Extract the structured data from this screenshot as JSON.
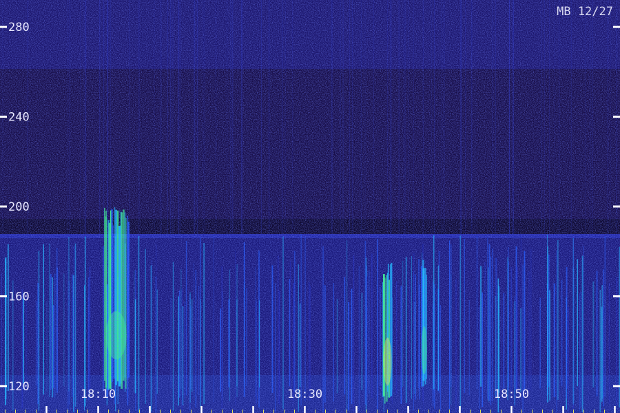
{
  "chart_data": {
    "type": "heatmap",
    "title": "",
    "stamp": "MB 12/27",
    "xlabel": "",
    "ylabel": "",
    "y_ticks": [
      280,
      240,
      200,
      160,
      120
    ],
    "ylim": [
      108,
      292
    ],
    "x_tick_labels": [
      {
        "time": "18:10",
        "minute": 10
      },
      {
        "time": "18:30",
        "minute": 30
      },
      {
        "time": "18:50",
        "minute": 50
      }
    ],
    "xlim_minutes": [
      0.5,
      60.5
    ],
    "minor_tick_every_minutes": 5,
    "colormap": [
      "#1a1050",
      "#1e2ab8",
      "#1f5cff",
      "#19c0ff",
      "#3cff8a",
      "#f0ff40"
    ],
    "intensity_events": [
      {
        "label": "broadband burst",
        "minute_start": 10.5,
        "minute_end": 13,
        "freq_low": 118,
        "freq_high": 200,
        "level": 0.85
      },
      {
        "label": "burst",
        "minute_start": 37.5,
        "minute_end": 38.5,
        "freq_low": 112,
        "freq_high": 175,
        "level": 0.9
      },
      {
        "label": "burst",
        "minute_start": 41.3,
        "minute_end": 41.8,
        "freq_low": 118,
        "freq_high": 178,
        "level": 0.7
      }
    ],
    "grid": false,
    "legend": "none"
  }
}
